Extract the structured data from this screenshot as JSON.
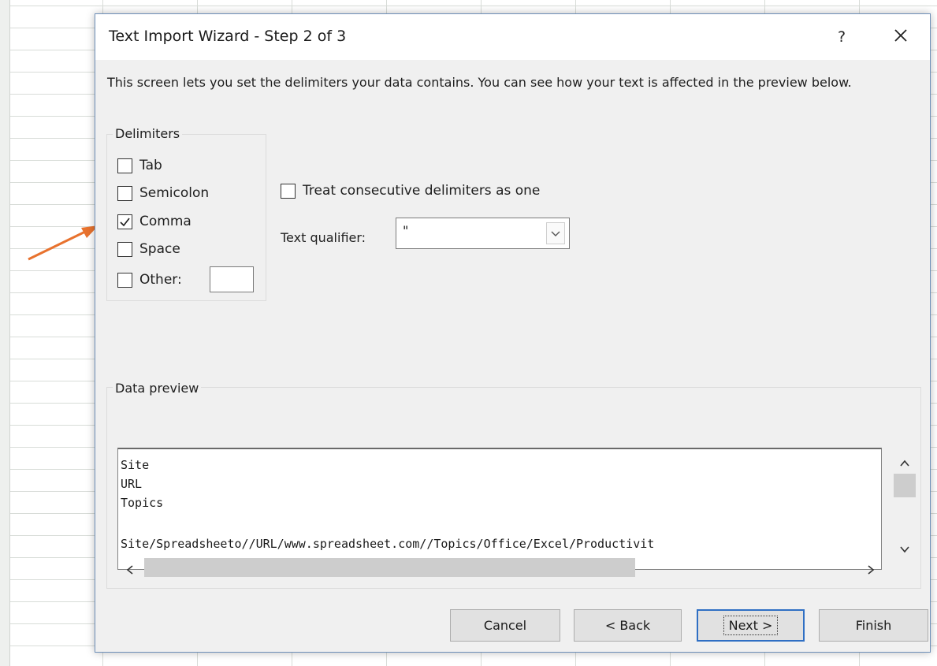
{
  "dialog": {
    "title": "Text Import Wizard - Step 2 of 3",
    "help_label": "?",
    "description": "This screen lets you set the delimiters your data contains.  You can see how your text is affected in the preview below."
  },
  "delimiters": {
    "legend": "Delimiters",
    "tab": {
      "label": "Tab",
      "checked": false
    },
    "semicolon": {
      "label": "Semicolon",
      "checked": false
    },
    "comma": {
      "label": "Comma",
      "checked": true
    },
    "space": {
      "label": "Space",
      "checked": false
    },
    "other": {
      "label": "Other:",
      "checked": false,
      "value": ""
    }
  },
  "options": {
    "consecutive_label": "Treat consecutive delimiters as one",
    "consecutive_checked": false,
    "qualifier_label": "Text qualifier:",
    "qualifier_value": "\""
  },
  "preview": {
    "legend": "Data preview",
    "lines": [
      "Site",
      "URL",
      "Topics",
      "",
      "Site/Spreadsheeto//URL/www.spreadsheet.com//Topics/Office/Excel/Productivit"
    ]
  },
  "buttons": {
    "cancel": "Cancel",
    "back": "< Back",
    "next": "Next >",
    "finish": "Finish"
  },
  "colors": {
    "arrow": "#e8722e",
    "dialog_border": "#6d8fb8",
    "default_button_border": "#2f6fc4"
  }
}
